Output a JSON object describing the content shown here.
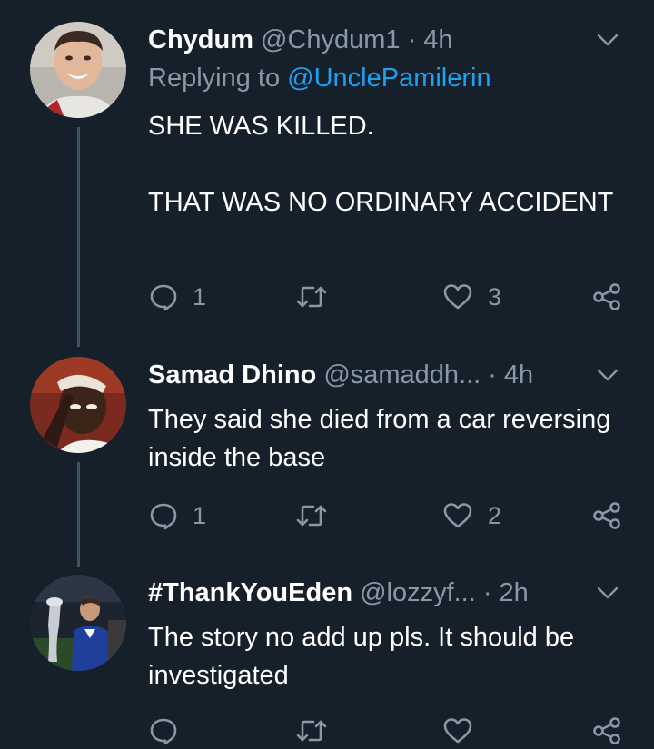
{
  "tweets": [
    {
      "name": "Chydum",
      "handle": "@Chydum1",
      "separator": "·",
      "time": "4h",
      "replying_prefix": "Replying to ",
      "replying_handle": "@UnclePamilerin",
      "text": "SHE WAS KILLED.\n\nTHAT WAS NO ORDINARY ACCIDENT",
      "reply_count": "1",
      "retweet_count": "",
      "like_count": "3"
    },
    {
      "name": "Samad Dhino",
      "handle": "@samaddh...",
      "separator": "·",
      "time": "4h",
      "text": "They said she died from a car reversing inside the base",
      "reply_count": "1",
      "retweet_count": "",
      "like_count": "2"
    },
    {
      "name": "#ThankYouEden",
      "handle": "@lozzyf...",
      "separator": "·",
      "time": "2h",
      "text": "The story no add up pls. It should be investigated",
      "reply_count": "",
      "retweet_count": "",
      "like_count": ""
    }
  ],
  "icons": {
    "reply": "reply-icon",
    "retweet": "retweet-icon",
    "like": "heart-icon",
    "share": "share-icon",
    "menu": "chevron-down-icon"
  },
  "colors": {
    "background": "#15202b",
    "secondary_text": "#8899a6",
    "link": "#1da1f2",
    "thread_line": "#3d5466"
  }
}
